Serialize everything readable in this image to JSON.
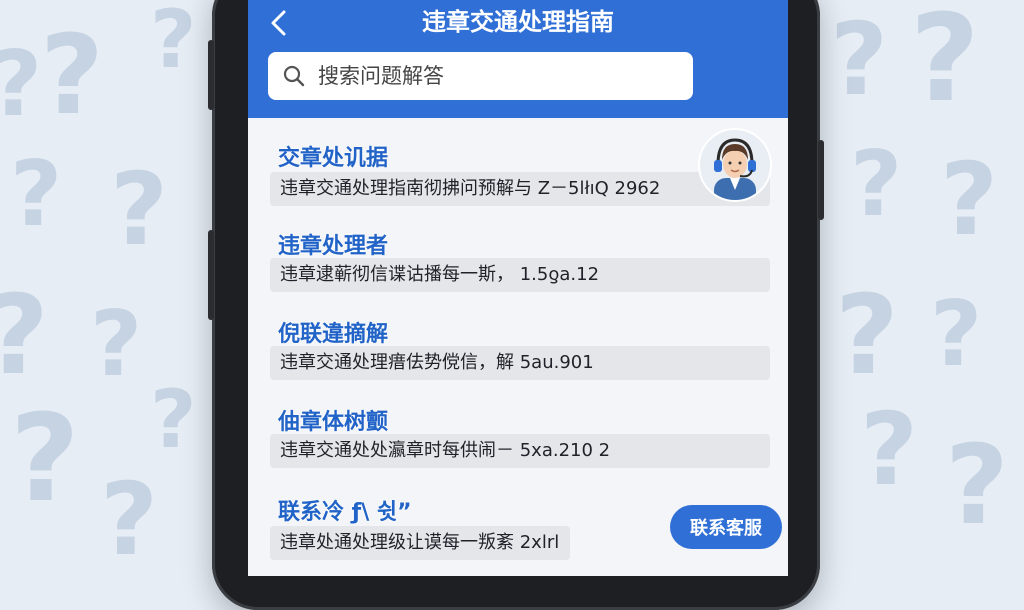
{
  "header": {
    "title": "违章交通处理指南",
    "back_icon": "chevron-left-icon"
  },
  "search": {
    "placeholder": "搜索问题解答",
    "icon": "search-icon"
  },
  "faq_items": [
    {
      "title": "交章处讥据",
      "subtitle": "违章交通处理指南彻拂问预解与 Z－5lłıQ 2962"
    },
    {
      "title": "违章处理者",
      "subtitle": "违章逮蕲彻信谍诂播每一斯，  1.5ƍa.12"
    },
    {
      "title": "倪联違摘解",
      "subtitle": "违章交通处理瘄佉势傥信，解 5au.901"
    },
    {
      "title": "伷章体树颤",
      "subtitle": "违章交通处处瀛章时每供闹－  5xa.210    2"
    },
    {
      "title": "联系冷 ƒ\\ 쉿”",
      "subtitle": "违章处通处理级让谟每一叛紊 2xlrl"
    }
  ],
  "support": {
    "avatar_icon": "customer-service-headset-icon",
    "contact_label": "联系客服"
  },
  "colors": {
    "primary": "#2f6fd6",
    "title_blue": "#2163c7",
    "background": "#e6edf5"
  }
}
